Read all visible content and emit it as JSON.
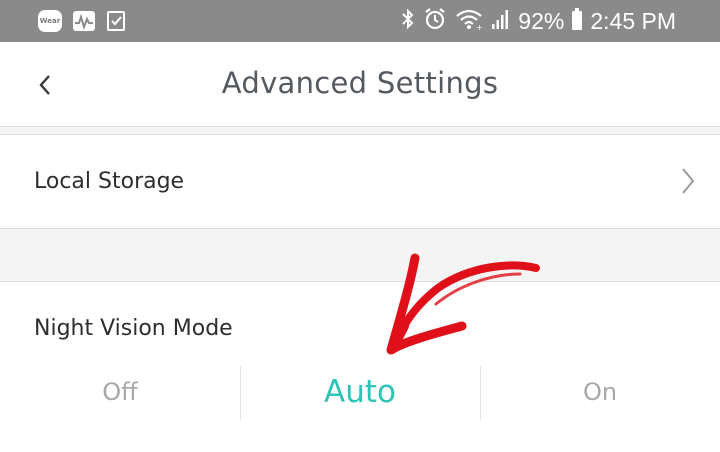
{
  "status_bar": {
    "wear_label": "Wear",
    "battery": "92%",
    "time": "2:45 PM",
    "icons": [
      "wear-app-icon",
      "activity-icon",
      "checkbox-icon",
      "bluetooth-icon",
      "alarm-icon",
      "wifi-icon",
      "signal-icon",
      "battery-icon"
    ]
  },
  "header": {
    "title": "Advanced Settings",
    "back_icon": "chevron-left-icon"
  },
  "settings": {
    "local_storage_label": "Local Storage",
    "local_storage_icon": "chevron-right-icon",
    "night_vision_label": "Night Vision Mode",
    "night_vision_options": [
      "Off",
      "Auto",
      "On"
    ],
    "night_vision_selected": "Auto"
  },
  "colors": {
    "status_bar": "#8a8a8a",
    "accent": "#2ec4b6",
    "annotation_arrow": "#e0101a"
  }
}
